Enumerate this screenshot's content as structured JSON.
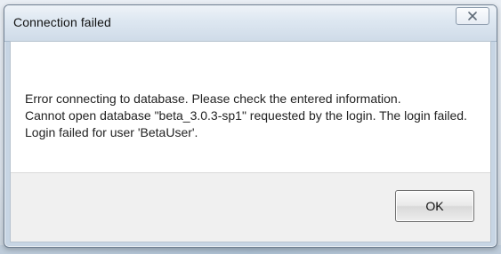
{
  "window": {
    "title": "Connection failed"
  },
  "titlebar": {
    "close_icon": "close-icon"
  },
  "message": {
    "lines": [
      "Error connecting to database. Please check the entered information.",
      "Cannot open database \"beta_3.0.3-sp1\" requested by the login. The login failed.",
      "Login failed for user 'BetaUser'."
    ]
  },
  "buttons": {
    "ok_label": "OK"
  }
}
